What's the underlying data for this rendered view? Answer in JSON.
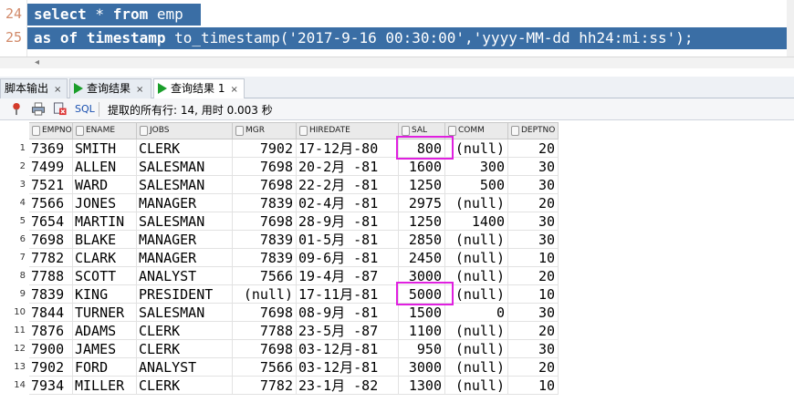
{
  "editor": {
    "lines": [
      {
        "num": "24",
        "parts": [
          [
            "kw",
            "select"
          ],
          [
            "t",
            " * "
          ],
          [
            "kw",
            "from"
          ],
          [
            "t",
            " emp"
          ]
        ]
      },
      {
        "num": "25",
        "parts": [
          [
            "kw",
            "as"
          ],
          [
            "t",
            " "
          ],
          [
            "kw",
            "of"
          ],
          [
            "t",
            " "
          ],
          [
            "kw",
            "timestamp"
          ],
          [
            "t",
            " to_timestamp('2017-9-16 00:30:00','yyyy-MM-dd hh24:mi:ss');"
          ]
        ]
      }
    ]
  },
  "scroll_arrow": "◂",
  "tabs": [
    {
      "label": "脚本输出",
      "close": "×"
    },
    {
      "label": "查询结果",
      "close": "×"
    },
    {
      "label": "查询结果 1",
      "close": "×"
    }
  ],
  "toolbar": {
    "sql_label": "SQL",
    "separator": "|",
    "status": "提取的所有行: 14, 用时 0.003 秒"
  },
  "table": {
    "columns": [
      "EMPNO",
      "ENAME",
      "JOBS",
      "MGR",
      "HIREDATE",
      "SAL",
      "COMM",
      "DEPTNO"
    ],
    "rows": [
      [
        "7369",
        "SMITH",
        "CLERK",
        "7902",
        "17-12月-80",
        "800",
        "(null)",
        "20"
      ],
      [
        "7499",
        "ALLEN",
        "SALESMAN",
        "7698",
        "20-2月 -81",
        "1600",
        "300",
        "30"
      ],
      [
        "7521",
        "WARD",
        "SALESMAN",
        "7698",
        "22-2月 -81",
        "1250",
        "500",
        "30"
      ],
      [
        "7566",
        "JONES",
        "MANAGER",
        "7839",
        "02-4月 -81",
        "2975",
        "(null)",
        "20"
      ],
      [
        "7654",
        "MARTIN",
        "SALESMAN",
        "7698",
        "28-9月 -81",
        "1250",
        "1400",
        "30"
      ],
      [
        "7698",
        "BLAKE",
        "MANAGER",
        "7839",
        "01-5月 -81",
        "2850",
        "(null)",
        "30"
      ],
      [
        "7782",
        "CLARK",
        "MANAGER",
        "7839",
        "09-6月 -81",
        "2450",
        "(null)",
        "10"
      ],
      [
        "7788",
        "SCOTT",
        "ANALYST",
        "7566",
        "19-4月 -87",
        "3000",
        "(null)",
        "20"
      ],
      [
        "7839",
        "KING",
        "PRESIDENT",
        "(null)",
        "17-11月-81",
        "5000",
        "(null)",
        "10"
      ],
      [
        "7844",
        "TURNER",
        "SALESMAN",
        "7698",
        "08-9月 -81",
        "1500",
        "0",
        "30"
      ],
      [
        "7876",
        "ADAMS",
        "CLERK",
        "7788",
        "23-5月 -87",
        "1100",
        "(null)",
        "20"
      ],
      [
        "7900",
        "JAMES",
        "CLERK",
        "7698",
        "03-12月-81",
        "950",
        "(null)",
        "30"
      ],
      [
        "7902",
        "FORD",
        "ANALYST",
        "7566",
        "03-12月-81",
        "3000",
        "(null)",
        "20"
      ],
      [
        "7934",
        "MILLER",
        "CLERK",
        "7782",
        "23-1月 -82",
        "1300",
        "(null)",
        "10"
      ]
    ]
  },
  "colors": {
    "highlight_box": "#e020e0",
    "selection": "#3a6ea5"
  }
}
